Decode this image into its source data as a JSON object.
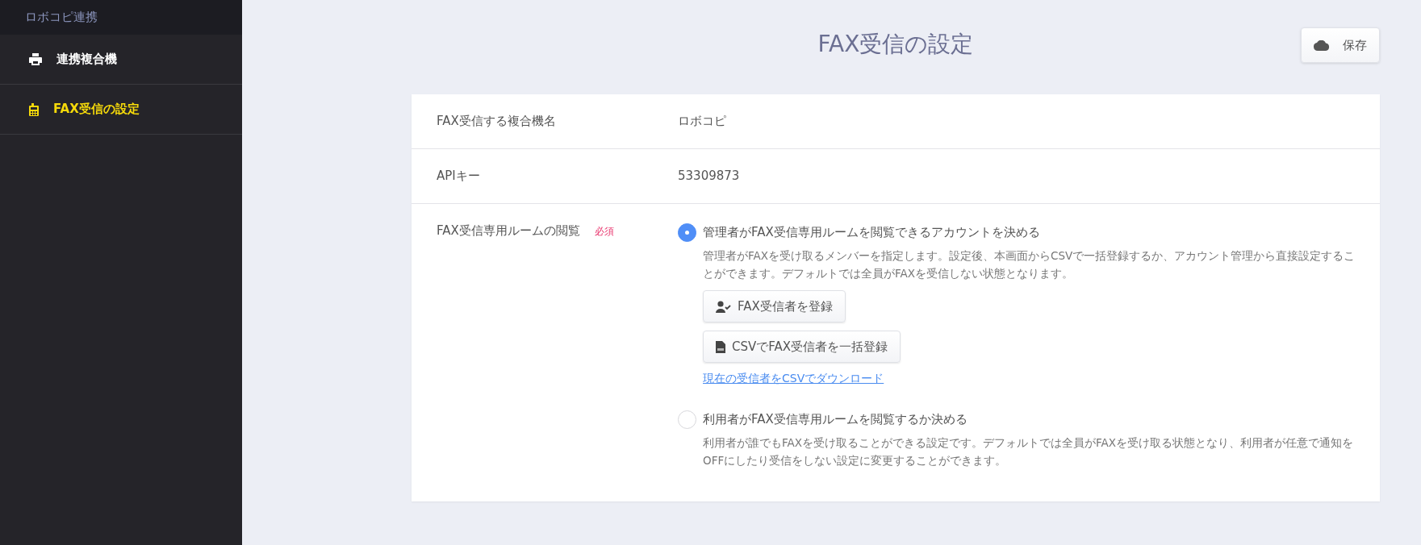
{
  "sidebar": {
    "header": "ロボコピ連携",
    "items": [
      {
        "label": "連携複合機",
        "kind": "printer",
        "selected": false
      },
      {
        "label": "FAX受信の設定",
        "kind": "fax",
        "selected": true
      }
    ]
  },
  "page": {
    "title": "FAX受信の設定",
    "save_button": "保存"
  },
  "form": {
    "rows": [
      {
        "kind": "text",
        "label": "FAX受信する複合機名",
        "value": "ロボコピ"
      },
      {
        "kind": "text",
        "label": "APIキー",
        "value": "53309873"
      },
      {
        "kind": "radio",
        "label": "FAX受信専用ルームの閲覧",
        "required": "必須",
        "options": [
          {
            "label": "管理者がFAX受信専用ルームを閲覧できるアカウントを決める",
            "selected": true,
            "description": "管理者がFAXを受け取るメンバーを指定します。設定後、本画面からCSVで一括登録するか、アカウント管理から直接設定することができます。デフォルトでは全員がFAXを受信しない状態となります。",
            "buttons": [
              {
                "kind": "user",
                "label": "FAX受信者を登録"
              },
              {
                "kind": "csv",
                "label": "CSVでFAX受信者を一括登録"
              }
            ],
            "link": "現在の受信者をCSVでダウンロード"
          },
          {
            "label": "利用者がFAX受信専用ルームを閲覧するか決める",
            "selected": false,
            "description": "利用者が誰でもFAXを受け取ることができる設定です。デフォルトでは全員がFAXを受け取る状態となり、利用者が任意で通知をOFFにしたり受信をしない設定に変更することができます。"
          }
        ]
      }
    ]
  }
}
